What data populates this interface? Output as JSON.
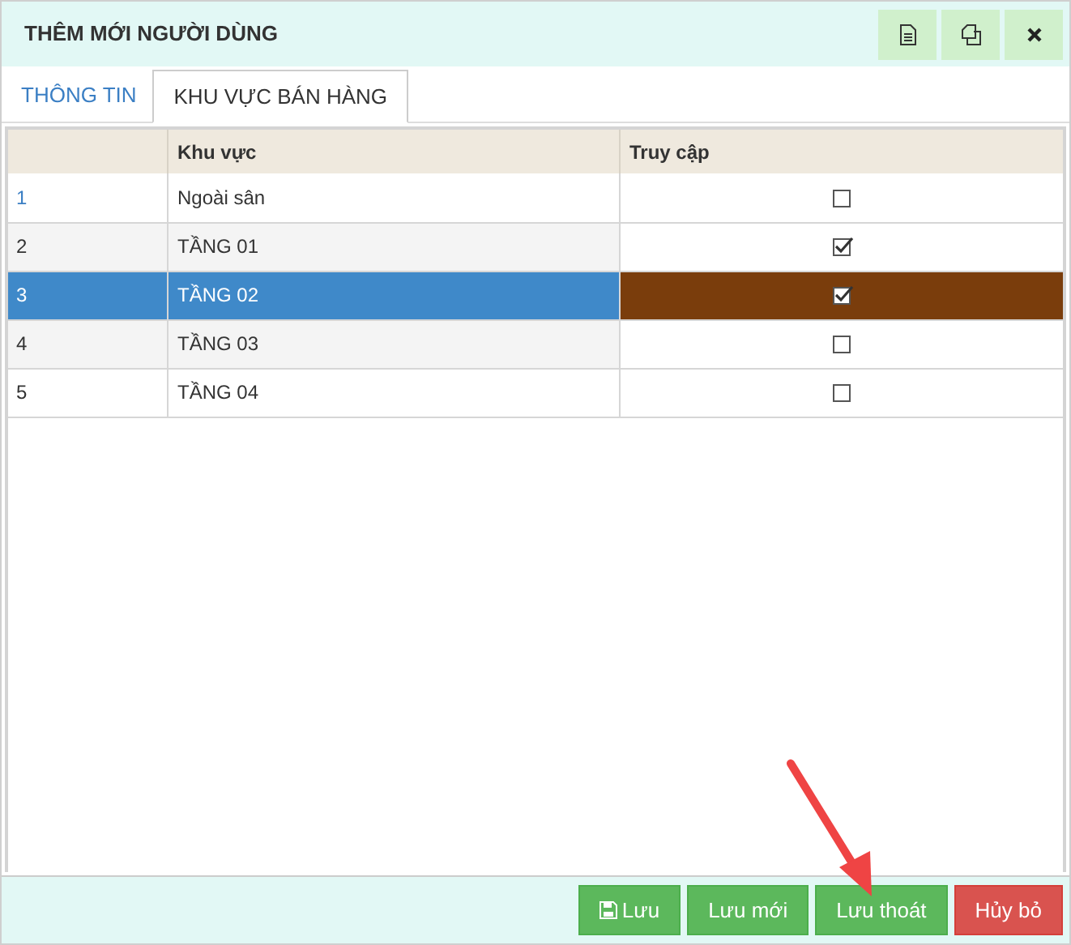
{
  "window": {
    "title": "THÊM MỚI NGƯỜI DÙNG"
  },
  "tabs": [
    {
      "label": "THÔNG TIN",
      "selected": false
    },
    {
      "label": "KHU VỰC BÁN HÀNG",
      "selected": true
    }
  ],
  "table": {
    "columns": [
      "Khu vực",
      "Truy cập"
    ],
    "rows": [
      {
        "index": "1",
        "area": "Ngoài sân",
        "checked": false,
        "selected": false
      },
      {
        "index": "2",
        "area": "TẦNG 01",
        "checked": true,
        "selected": false
      },
      {
        "index": "3",
        "area": "TẦNG 02",
        "checked": true,
        "selected": true
      },
      {
        "index": "4",
        "area": "TẦNG 03",
        "checked": false,
        "selected": false
      },
      {
        "index": "5",
        "area": "TẦNG 04",
        "checked": false,
        "selected": false
      }
    ]
  },
  "buttons": [
    {
      "label": "Lưu",
      "kind": "save"
    },
    {
      "label": "Lưu mới",
      "kind": "success"
    },
    {
      "label": "Lưu thoát",
      "kind": "success"
    },
    {
      "label": "Hủy bỏ",
      "kind": "danger"
    }
  ]
}
